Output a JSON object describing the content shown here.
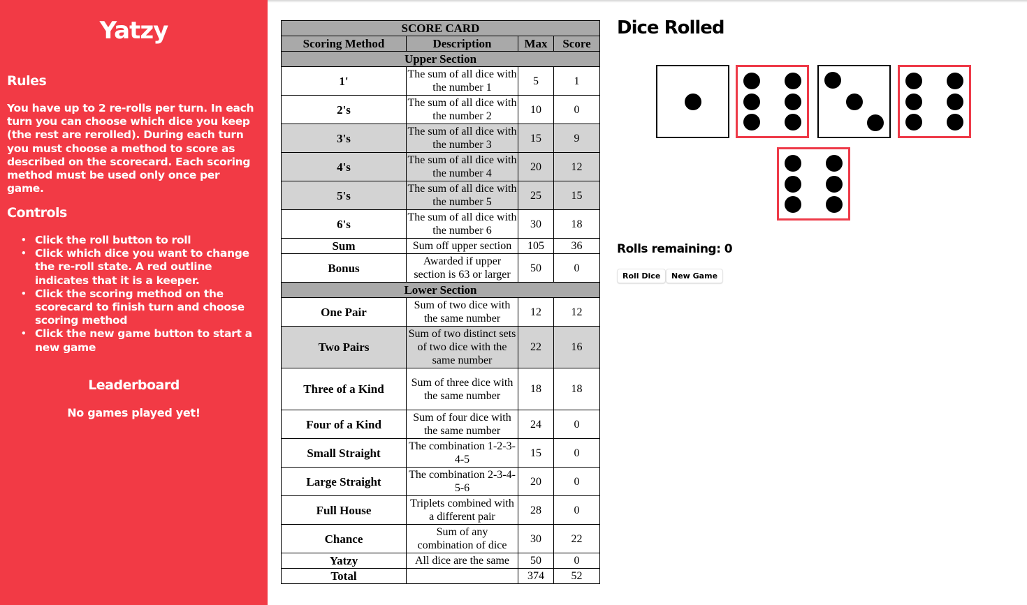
{
  "sidebar": {
    "title": "Yatzy",
    "rules_heading": "Rules",
    "rules_text": "You have up to 2 re-rolls per turn. In each turn you can choose which dice you keep (the rest are rerolled). During each turn you must choose a method to score as described on the scorecard. Each scoring method must be used only once per game.",
    "controls_heading": "Controls",
    "controls": [
      "Click the roll button to roll",
      "Click which dice you want to change the re-roll state. A red outline indicates that it is a keeper.",
      "Click the scoring method on the scorecard to finish turn and choose scoring method",
      "Click the new game button to start a new game"
    ],
    "leaderboard_heading": "Leaderboard",
    "leaderboard_empty": "No games played yet!"
  },
  "scorecard": {
    "title": "SCORE CARD",
    "columns": [
      "Scoring Method",
      "Description",
      "Max",
      "Score"
    ],
    "upper_label": "Upper Section",
    "lower_label": "Lower Section",
    "upper_rows": [
      {
        "method": "1'",
        "desc": "The sum of all dice with the number 1",
        "max": "5",
        "score": "1"
      },
      {
        "method": "2's",
        "desc": "The sum of all dice with the number 2",
        "max": "10",
        "score": "0"
      },
      {
        "method": "3's",
        "desc": "The sum of all dice with the number 3",
        "max": "15",
        "score": "9"
      },
      {
        "method": "4's",
        "desc": "The sum of all dice with the number 4",
        "max": "20",
        "score": "12"
      },
      {
        "method": "5's",
        "desc": "The sum of all dice with the number 5",
        "max": "25",
        "score": "15"
      },
      {
        "method": "6's",
        "desc": "The sum of all dice with the number 6",
        "max": "30",
        "score": "18"
      }
    ],
    "sum_row": {
      "method": "Sum",
      "desc": "Sum off upper section",
      "max": "105",
      "score": "36"
    },
    "bonus_row": {
      "method": "Bonus",
      "desc": "Awarded if upper section is 63 or larger",
      "max": "50",
      "score": "0"
    },
    "lower_rows": [
      {
        "method": "One Pair",
        "desc": "Sum of two dice with the same number",
        "max": "12",
        "score": "12"
      },
      {
        "method": "Two Pairs",
        "desc": "Sum of two distinct sets of two dice with the same number",
        "max": "22",
        "score": "16"
      },
      {
        "method": "Three of a Kind",
        "desc": "Sum of three dice with the same number",
        "max": "18",
        "score": "18"
      },
      {
        "method": "Four of a Kind",
        "desc": "Sum of four dice with the same number",
        "max": "24",
        "score": "0"
      },
      {
        "method": "Small Straight",
        "desc": "The combination 1-2-3-4-5",
        "max": "15",
        "score": "0"
      },
      {
        "method": "Large Straight",
        "desc": "The combination 2-3-4-5-6",
        "max": "20",
        "score": "0"
      },
      {
        "method": "Full House",
        "desc": "Triplets combined with a different pair",
        "max": "28",
        "score": "0"
      },
      {
        "method": "Chance",
        "desc": "Sum of any combination of dice",
        "max": "30",
        "score": "22"
      },
      {
        "method": "Yatzy",
        "desc": "All dice are the same",
        "max": "50",
        "score": "0"
      }
    ],
    "total_row": {
      "method": "Total",
      "desc": "",
      "max": "374",
      "score": "52"
    }
  },
  "dice_panel": {
    "title": "Dice Rolled",
    "dice": [
      {
        "value": 1,
        "kept": false
      },
      {
        "value": 6,
        "kept": true
      },
      {
        "value": 3,
        "kept": false
      },
      {
        "value": 6,
        "kept": true
      },
      {
        "value": 6,
        "kept": true
      }
    ],
    "rolls_remaining": "Rolls remaining: 0",
    "roll_button": "Roll Dice",
    "new_game_button": "New Game",
    "keep_color": "#ee3a48"
  },
  "colors": {
    "sidebar_bg": "#f23a45",
    "header_bg": "#a9a9a9",
    "used_row_bg": "#d3d3d3"
  }
}
